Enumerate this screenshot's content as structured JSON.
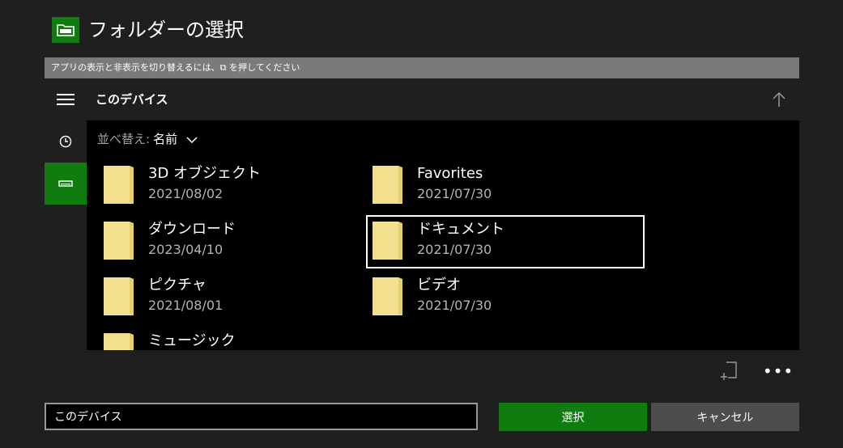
{
  "window": {
    "title": "フォルダーの選択",
    "icon": "folder-picker-icon",
    "accent_color": "#107c10"
  },
  "hint": "アプリの表示と非表示を切り替えるには、⧉ を押してください",
  "nav": {
    "items": [
      {
        "name": "menu",
        "icon": "hamburger-menu-icon"
      },
      {
        "name": "recent",
        "icon": "clock-icon"
      },
      {
        "name": "this-device",
        "icon": "drive-icon",
        "selected": true
      }
    ]
  },
  "header": {
    "location": "このデバイス",
    "up_icon": "arrow-up-icon"
  },
  "sort": {
    "label": "並べ替え:",
    "value": "名前"
  },
  "folders": [
    {
      "name": "3D オブジェクト",
      "date": "2021/08/02"
    },
    {
      "name": "Favorites",
      "date": "2021/07/30"
    },
    {
      "name": "ダウンロード",
      "date": "2023/04/10"
    },
    {
      "name": "ドキュメント",
      "date": "2021/07/30",
      "focused": true
    },
    {
      "name": "ピクチャ",
      "date": "2021/08/01"
    },
    {
      "name": "ビデオ",
      "date": "2021/07/30"
    },
    {
      "name": "ミュージック",
      "date": ""
    }
  ],
  "commands": [
    {
      "name": "new-folder",
      "icon": "new-folder-icon"
    },
    {
      "name": "more",
      "icon": "more-icon",
      "label": "•••"
    }
  ],
  "footer": {
    "path": "このデバイス",
    "select_label": "選択",
    "cancel_label": "キャンセル"
  }
}
